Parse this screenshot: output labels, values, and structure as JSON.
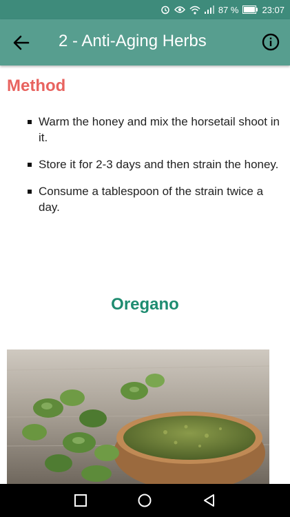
{
  "status_bar": {
    "battery_percent": "87 %",
    "time": "23:07",
    "icons": [
      "alarm-icon",
      "eye-icon",
      "wifi-icon",
      "signal-icon",
      "battery-icon"
    ]
  },
  "app_bar": {
    "title": "2 - Anti-Aging Herbs",
    "background_color": "#579e8f",
    "back_icon": "arrow-back-icon",
    "info_icon": "info-icon"
  },
  "method": {
    "heading": "Method",
    "heading_color": "#e8635f",
    "steps": [
      "Warm the honey and mix the horsetail shoot in it.",
      "Store it for 2-3 days and then strain the honey.",
      "Consume a tablespoon of the strain twice a day."
    ]
  },
  "section": {
    "heading": "Oregano",
    "heading_color": "#1e8c70"
  },
  "nav_bar": {
    "icons": [
      "recent-apps-icon",
      "home-icon",
      "back-triangle-icon"
    ]
  }
}
